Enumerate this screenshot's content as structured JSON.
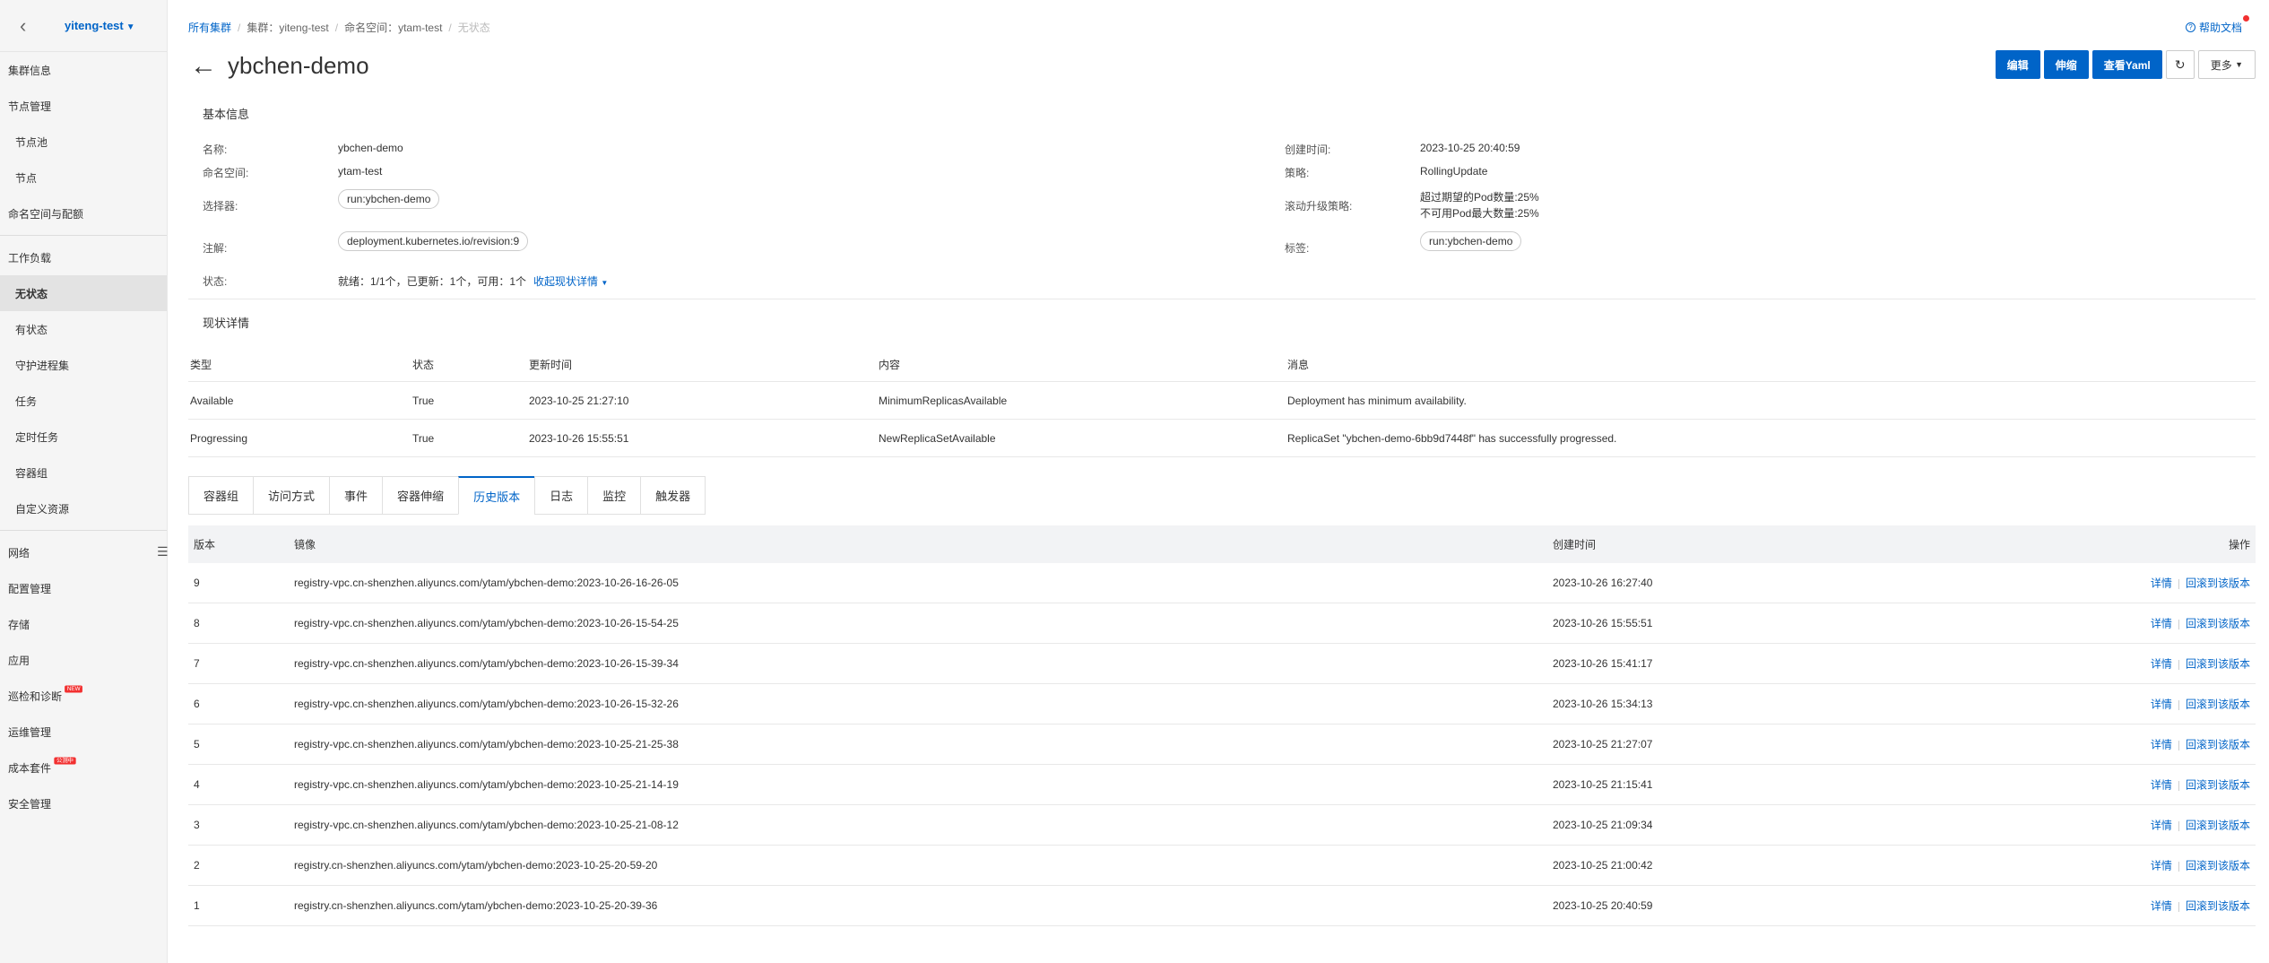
{
  "sidebar": {
    "cluster": "yiteng-test",
    "items": [
      {
        "label": "集群信息",
        "level": 1
      },
      {
        "label": "节点管理",
        "level": 1
      },
      {
        "label": "节点池",
        "level": 2
      },
      {
        "label": "节点",
        "level": 2
      },
      {
        "label": "命名空间与配额",
        "level": 1
      },
      {
        "label": "工作负载",
        "level": 1
      },
      {
        "label": "无状态",
        "level": 2,
        "active": true
      },
      {
        "label": "有状态",
        "level": 2
      },
      {
        "label": "守护进程集",
        "level": 2
      },
      {
        "label": "任务",
        "level": 2
      },
      {
        "label": "定时任务",
        "level": 2
      },
      {
        "label": "容器组",
        "level": 2
      },
      {
        "label": "自定义资源",
        "level": 2
      },
      {
        "label": "网络",
        "level": 1
      },
      {
        "label": "配置管理",
        "level": 1
      },
      {
        "label": "存储",
        "level": 1
      },
      {
        "label": "应用",
        "level": 1
      },
      {
        "label": "巡检和诊断",
        "level": 1,
        "badge": "NEW"
      },
      {
        "label": "运维管理",
        "level": 1
      },
      {
        "label": "成本套件",
        "level": 1,
        "badge": "公测中"
      },
      {
        "label": "安全管理",
        "level": 1
      }
    ]
  },
  "breadcrumb": {
    "all": "所有集群",
    "cluster": "集群：yiteng-test",
    "namespace": "命名空间：ytam-test",
    "current": "无状态"
  },
  "help": "帮助文档",
  "title": "ybchen-demo",
  "actions": {
    "edit": "编辑",
    "scale": "伸缩",
    "yaml": "查看Yaml",
    "more": "更多"
  },
  "basic": {
    "section": "基本信息",
    "name_label": "名称:",
    "name": "ybchen-demo",
    "ns_label": "命名空间:",
    "ns": "ytam-test",
    "selector_label": "选择器:",
    "selector": "run:ybchen-demo",
    "annotation_label": "注解:",
    "annotation": "deployment.kubernetes.io/revision:9",
    "status_label": "状态:",
    "status": "就绪：1/1个，已更新：1个，可用：1个",
    "status_toggle": "收起现状详情",
    "created_label": "创建时间:",
    "created": "2023-10-25 20:40:59",
    "strategy_label": "策略:",
    "strategy": "RollingUpdate",
    "rolling_label": "滚动升级策略:",
    "rolling_1": "超过期望的Pod数量:25%",
    "rolling_2": "不可用Pod最大数量:25%",
    "labels_label": "标签:",
    "labels": "run:ybchen-demo"
  },
  "conditions": {
    "section": "现状详情",
    "headers": [
      "类型",
      "状态",
      "更新时间",
      "内容",
      "消息"
    ],
    "rows": [
      [
        "Available",
        "True",
        "2023-10-25 21:27:10",
        "MinimumReplicasAvailable",
        "Deployment has minimum availability."
      ],
      [
        "Progressing",
        "True",
        "2023-10-26 15:55:51",
        "NewReplicaSetAvailable",
        "ReplicaSet \"ybchen-demo-6bb9d7448f\" has successfully progressed."
      ]
    ]
  },
  "tabs": [
    {
      "label": "容器组"
    },
    {
      "label": "访问方式"
    },
    {
      "label": "事件"
    },
    {
      "label": "容器伸缩"
    },
    {
      "label": "历史版本",
      "active": true
    },
    {
      "label": "日志"
    },
    {
      "label": "监控"
    },
    {
      "label": "触发器"
    }
  ],
  "history": {
    "headers": {
      "version": "版本",
      "image": "镜像",
      "created": "创建时间",
      "ops": "操作"
    },
    "detail_label": "详情",
    "rollback_label": "回滚到该版本",
    "rows": [
      {
        "version": "9",
        "image": "registry-vpc.cn-shenzhen.aliyuncs.com/ytam/ybchen-demo:2023-10-26-16-26-05",
        "created": "2023-10-26 16:27:40"
      },
      {
        "version": "8",
        "image": "registry-vpc.cn-shenzhen.aliyuncs.com/ytam/ybchen-demo:2023-10-26-15-54-25",
        "created": "2023-10-26 15:55:51"
      },
      {
        "version": "7",
        "image": "registry-vpc.cn-shenzhen.aliyuncs.com/ytam/ybchen-demo:2023-10-26-15-39-34",
        "created": "2023-10-26 15:41:17"
      },
      {
        "version": "6",
        "image": "registry-vpc.cn-shenzhen.aliyuncs.com/ytam/ybchen-demo:2023-10-26-15-32-26",
        "created": "2023-10-26 15:34:13"
      },
      {
        "version": "5",
        "image": "registry-vpc.cn-shenzhen.aliyuncs.com/ytam/ybchen-demo:2023-10-25-21-25-38",
        "created": "2023-10-25 21:27:07"
      },
      {
        "version": "4",
        "image": "registry-vpc.cn-shenzhen.aliyuncs.com/ytam/ybchen-demo:2023-10-25-21-14-19",
        "created": "2023-10-25 21:15:41"
      },
      {
        "version": "3",
        "image": "registry-vpc.cn-shenzhen.aliyuncs.com/ytam/ybchen-demo:2023-10-25-21-08-12",
        "created": "2023-10-25 21:09:34"
      },
      {
        "version": "2",
        "image": "registry.cn-shenzhen.aliyuncs.com/ytam/ybchen-demo:2023-10-25-20-59-20",
        "created": "2023-10-25 21:00:42"
      },
      {
        "version": "1",
        "image": "registry.cn-shenzhen.aliyuncs.com/ytam/ybchen-demo:2023-10-25-20-39-36",
        "created": "2023-10-25 20:40:59"
      }
    ]
  },
  "colors": {
    "primary": "#0064c8",
    "badge": "#f23030"
  }
}
